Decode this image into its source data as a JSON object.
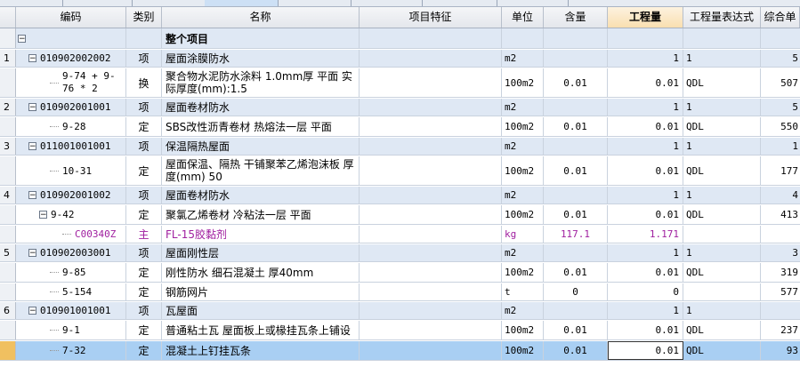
{
  "header": [
    "编码",
    "类别",
    "名称",
    "项目特征",
    "单位",
    "含量",
    "工程量",
    "工程量表达式",
    "综合单"
  ],
  "top_row": {
    "label": "整个项目"
  },
  "rows": [
    {
      "num": "1",
      "code": "010902002002",
      "type": "项",
      "name": "屋面涂膜防水",
      "unit": "m2",
      "content": "",
      "qty": "1",
      "expr": "1",
      "price": "5",
      "kind": "grp"
    },
    {
      "num": "",
      "code": "9-74 + 9-76 * 2",
      "type": "换",
      "name": "聚合物水泥防水涂料 1.0mm厚 平面  实际厚度(mm):1.5",
      "unit": "100m2",
      "content": "0.01",
      "qty": "0.01",
      "expr": "QDL",
      "price": "507",
      "kind": "sub"
    },
    {
      "num": "2",
      "code": "010902001001",
      "type": "项",
      "name": "屋面卷材防水",
      "unit": "m2",
      "content": "",
      "qty": "1",
      "expr": "1",
      "price": "5",
      "kind": "grp"
    },
    {
      "num": "",
      "code": "9-28",
      "type": "定",
      "name": "SBS改性沥青卷材 热熔法一层 平面",
      "unit": "100m2",
      "content": "0.01",
      "qty": "0.01",
      "expr": "QDL",
      "price": "550",
      "kind": "sub"
    },
    {
      "num": "3",
      "code": "011001001001",
      "type": "项",
      "name": "保温隔热屋面",
      "unit": "m2",
      "content": "",
      "qty": "1",
      "expr": "1",
      "price": "1",
      "kind": "grp"
    },
    {
      "num": "",
      "code": "10-31",
      "type": "定",
      "name": "屋面保温、隔热 干铺聚苯乙烯泡沫板 厚度(mm) 50",
      "unit": "100m2",
      "content": "0.01",
      "qty": "0.01",
      "expr": "QDL",
      "price": "177",
      "kind": "sub"
    },
    {
      "num": "4",
      "code": "010902001002",
      "type": "项",
      "name": "屋面卷材防水",
      "unit": "m2",
      "content": "",
      "qty": "1",
      "expr": "1",
      "price": "4",
      "kind": "grp"
    },
    {
      "num": "",
      "code": "9-42",
      "type": "定",
      "name": "聚氯乙烯卷材 冷粘法一层 平面",
      "unit": "100m2",
      "content": "0.01",
      "qty": "0.01",
      "expr": "QDL",
      "price": "413",
      "kind": "sub"
    },
    {
      "num": "",
      "code": "C00340Z",
      "type": "主",
      "name": "FL-15胶黏剂",
      "unit": "kg",
      "content": "117.1",
      "qty": "1.171",
      "expr": "",
      "price": "",
      "kind": "purple"
    },
    {
      "num": "5",
      "code": "010902003001",
      "type": "项",
      "name": "屋面刚性层",
      "unit": "m2",
      "content": "",
      "qty": "1",
      "expr": "1",
      "price": "3",
      "kind": "grp"
    },
    {
      "num": "",
      "code": "9-85",
      "type": "定",
      "name": "刚性防水 细石混凝土 厚40mm",
      "unit": "100m2",
      "content": "0.01",
      "qty": "0.01",
      "expr": "QDL",
      "price": "319",
      "kind": "sub"
    },
    {
      "num": "",
      "code": "5-154",
      "type": "定",
      "name": "钢筋网片",
      "unit": "t",
      "content": "0",
      "qty": "0",
      "expr": "",
      "price": "577",
      "kind": "sub"
    },
    {
      "num": "6",
      "code": "010901001001",
      "type": "项",
      "name": "瓦屋面",
      "unit": "m2",
      "content": "",
      "qty": "1",
      "expr": "1",
      "price": "",
      "kind": "grp"
    },
    {
      "num": "",
      "code": "9-1",
      "type": "定",
      "name": "普通粘土瓦 屋面板上或椽挂瓦条上铺设",
      "unit": "100m2",
      "content": "0.01",
      "qty": "0.01",
      "expr": "QDL",
      "price": "237",
      "kind": "sub"
    },
    {
      "num": "",
      "code": "7-32",
      "type": "定",
      "name": "混凝土上钉挂瓦条",
      "unit": "100m2",
      "content": "0.01",
      "qty": "0.01",
      "expr": "QDL",
      "price": "93",
      "kind": "sel"
    }
  ]
}
